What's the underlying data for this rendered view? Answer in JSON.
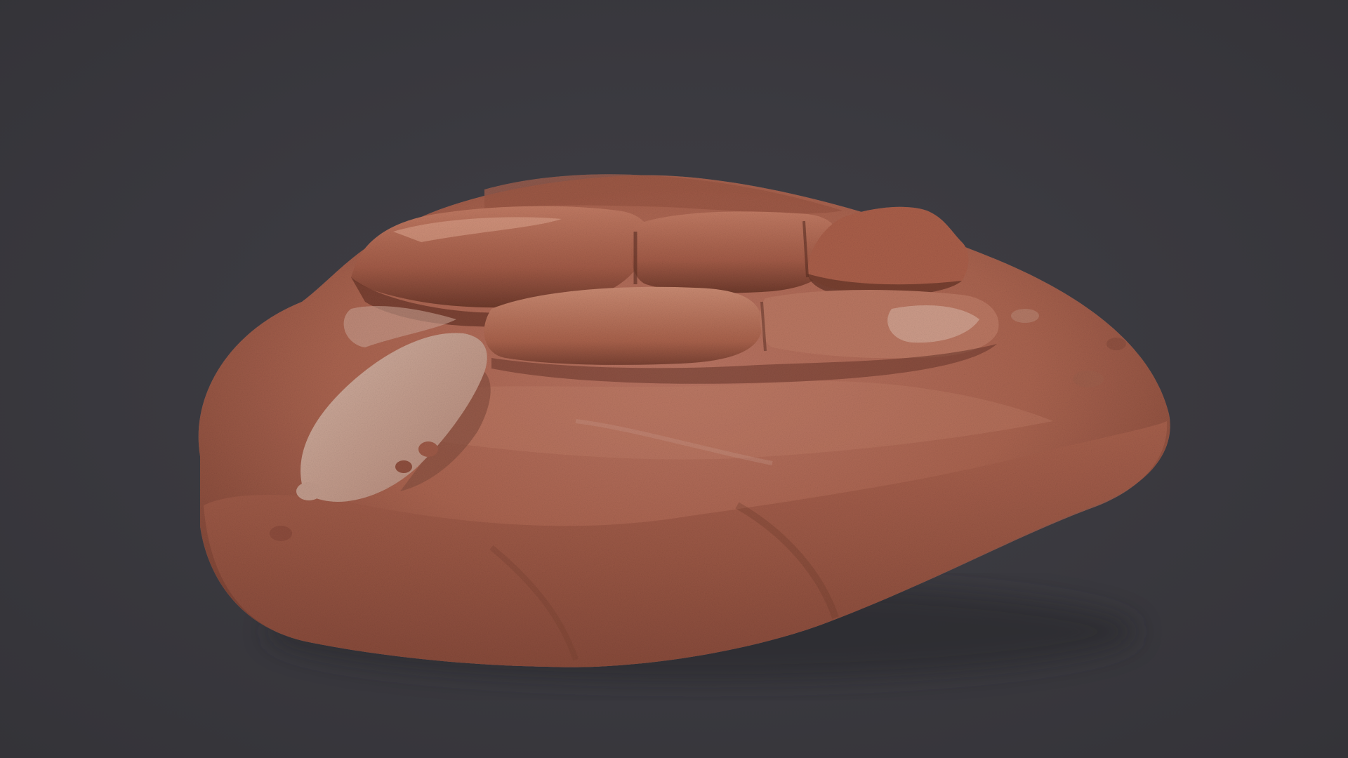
{
  "scene": {
    "subject": "rock-formation-3d-render",
    "colors": {
      "background": "#3a393e",
      "rock_base": "#b06a55",
      "rock_highlight": "#d49a84",
      "rock_pale": "#c8a79a",
      "rock_shadow": "#6e3a2c"
    }
  }
}
